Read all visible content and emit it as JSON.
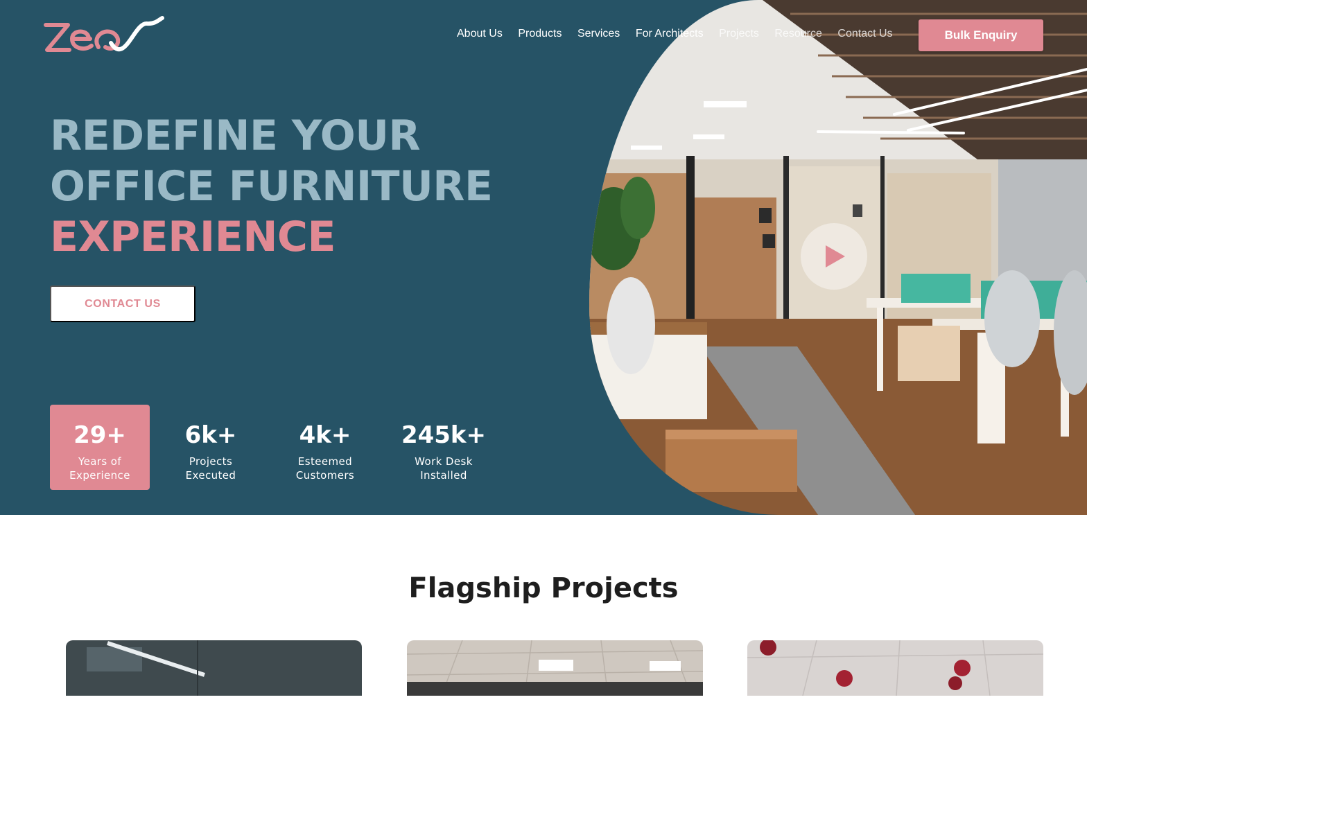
{
  "header": {
    "logo_text": "zeo",
    "nav": [
      {
        "label": "About Us"
      },
      {
        "label": "Products"
      },
      {
        "label": "Services"
      },
      {
        "label": "For Architects"
      },
      {
        "label": "Projects"
      },
      {
        "label": "Resource"
      },
      {
        "label": "Contact Us"
      }
    ],
    "bulk_button": "Bulk Enquiry"
  },
  "hero": {
    "headline_line1": "REDEFINE YOUR",
    "headline_line2": "OFFICE FURNITURE",
    "headline_line3": "EXPERIENCE",
    "contact_button": "CONTACT US",
    "stats": [
      {
        "value": "29+",
        "label_line1": "Years of",
        "label_line2": "Experience"
      },
      {
        "value": "6k+",
        "label_line1": "Projects",
        "label_line2": "Executed"
      },
      {
        "value": "4k+",
        "label_line1": "Esteemed",
        "label_line2": "Customers"
      },
      {
        "value": "245k+",
        "label_line1": "Work Desk",
        "label_line2": "Installed"
      }
    ]
  },
  "flagship": {
    "title": "Flagship Projects"
  },
  "colors": {
    "hero_bg": "#265366",
    "accent_pink": "#e08993",
    "muted_headline": "#9ab9c6"
  },
  "icons": {
    "play": "play-icon",
    "logo": "zeo-logo"
  }
}
